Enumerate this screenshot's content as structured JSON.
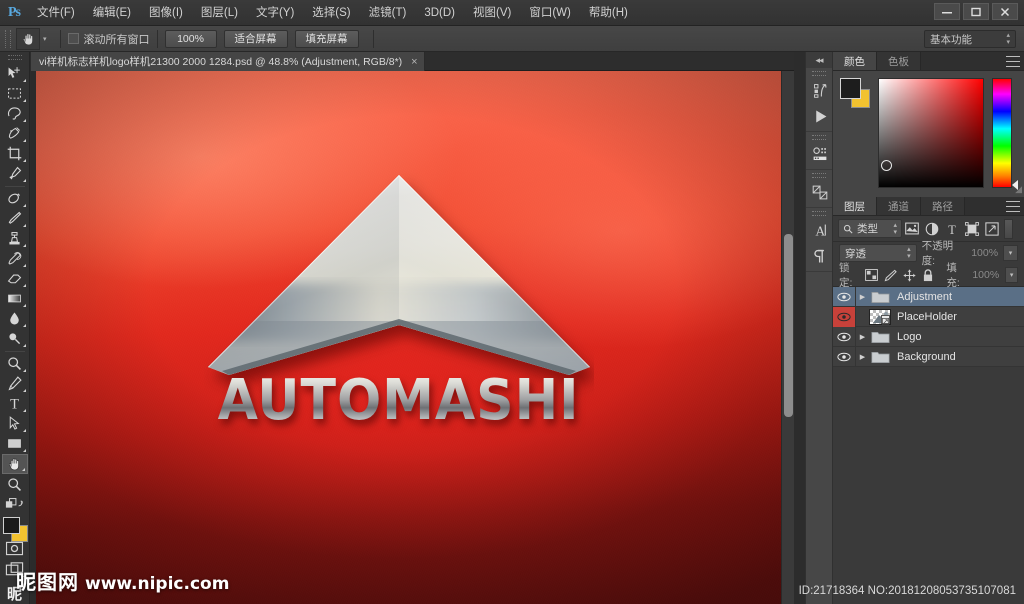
{
  "app": {
    "logo_text": "Ps",
    "workspace": "基本功能"
  },
  "menubar": {
    "items": [
      {
        "label": "文件(F)"
      },
      {
        "label": "编辑(E)"
      },
      {
        "label": "图像(I)"
      },
      {
        "label": "图层(L)"
      },
      {
        "label": "文字(Y)"
      },
      {
        "label": "选择(S)"
      },
      {
        "label": "滤镜(T)"
      },
      {
        "label": "3D(D)"
      },
      {
        "label": "视图(V)"
      },
      {
        "label": "窗口(W)"
      },
      {
        "label": "帮助(H)"
      }
    ]
  },
  "window_controls": {
    "minimize": "—",
    "maximize": "❐",
    "close": "✕"
  },
  "options_bar": {
    "active_tool_icon": "hand-tool-icon",
    "scroll_all_windows_label": "滚动所有窗口",
    "scroll_all_windows_checked": false,
    "buttons": [
      {
        "label": "100%"
      },
      {
        "label": "适合屏幕"
      },
      {
        "label": "填充屏幕"
      }
    ]
  },
  "toolbox": {
    "tools": [
      {
        "name": "move-tool",
        "icon": "move-icon",
        "has_submenu": true
      },
      {
        "name": "rectangular-select-tool",
        "icon": "marquee-icon",
        "has_submenu": true
      },
      {
        "name": "lasso-tool",
        "icon": "lasso-icon",
        "has_submenu": true
      },
      {
        "name": "quick-selection-tool",
        "icon": "quick-select-icon",
        "has_submenu": true
      },
      {
        "name": "crop-tool",
        "icon": "crop-icon",
        "has_submenu": true
      },
      {
        "name": "eyedropper-tool",
        "icon": "eyedropper-icon",
        "has_submenu": true
      },
      {
        "name": "spot-healing-tool",
        "icon": "healing-icon",
        "has_submenu": true
      },
      {
        "name": "brush-tool",
        "icon": "brush-icon",
        "has_submenu": true
      },
      {
        "name": "clone-stamp-tool",
        "icon": "stamp-icon",
        "has_submenu": true
      },
      {
        "name": "history-brush-tool",
        "icon": "history-brush-icon",
        "has_submenu": true
      },
      {
        "name": "eraser-tool",
        "icon": "eraser-icon",
        "has_submenu": true
      },
      {
        "name": "gradient-tool",
        "icon": "gradient-icon",
        "has_submenu": true
      },
      {
        "name": "blur-tool",
        "icon": "blur-drop-icon",
        "has_submenu": true
      },
      {
        "name": "dodge-tool",
        "icon": "dodge-icon",
        "has_submenu": true
      },
      {
        "name": "pen-tool",
        "icon": "pen-icon",
        "has_submenu": true
      },
      {
        "name": "type-tool",
        "icon": "type-T-icon",
        "has_submenu": true
      },
      {
        "name": "path-selection-tool",
        "icon": "path-arrow-icon",
        "has_submenu": true
      },
      {
        "name": "rectangle-shape-tool",
        "icon": "rectangle-icon",
        "has_submenu": true
      },
      {
        "name": "hand-tool",
        "icon": "hand-icon",
        "has_submenu": true,
        "active": true
      },
      {
        "name": "zoom-tool",
        "icon": "magnifier-icon",
        "has_submenu": false
      }
    ],
    "foreground_color": "#1a1a1a",
    "background_color": "#f2c230",
    "quick_mask_icon": "quick-mask-icon",
    "screen_mode_icon": "screen-mode-icon",
    "watermark_glyph": "昵"
  },
  "document": {
    "tab_title": "vi样机标志样机logo样机21300 2000 1284.psd @ 48.8% (Adjustment, RGB/8*)",
    "tab_close": "×",
    "zoom_level": "48.8%",
    "color_mode": "RGB/8*",
    "active_layer": "Adjustment"
  },
  "artwork": {
    "brand_text": "AUTOMASHINE",
    "logo_shape": "chevron-arrow-logo",
    "background_colors": [
      "#fb6d52",
      "#e02a1d",
      "#731210"
    ]
  },
  "icon_dock": {
    "collapse_icon": "collapse-panels-icon",
    "groups": [
      {
        "icons": [
          {
            "name": "history-panel-icon"
          },
          {
            "name": "actions-play-icon"
          }
        ]
      },
      {
        "icons": [
          {
            "name": "properties-panel-icon"
          }
        ]
      },
      {
        "icons": [
          {
            "name": "adjustments-panel-icon"
          }
        ]
      },
      {
        "icons": [
          {
            "name": "character-panel-icon"
          },
          {
            "name": "paragraph-panel-icon"
          }
        ]
      }
    ]
  },
  "color_panel": {
    "tabs": [
      {
        "label": "颜色",
        "active": true
      },
      {
        "label": "色板",
        "active": false
      }
    ],
    "foreground_color": "#1d1d1d",
    "background_color": "#f2c230",
    "picker": "hsb-square-with-hue-strip"
  },
  "layers_panel": {
    "tabs": [
      {
        "label": "图层",
        "active": true
      },
      {
        "label": "通道",
        "active": false
      },
      {
        "label": "路径",
        "active": false
      }
    ],
    "filter": {
      "kind_label": "类型",
      "search_icon": "search-icon",
      "filter_icons": [
        {
          "name": "filter-pixel-icon"
        },
        {
          "name": "filter-adjustment-icon"
        },
        {
          "name": "filter-type-icon"
        },
        {
          "name": "filter-shape-icon"
        },
        {
          "name": "filter-smart-object-icon"
        }
      ],
      "toggle_icon": "filter-enable-toggle"
    },
    "blend_mode": "穿透",
    "opacity_label": "不透明度:",
    "opacity_value": "100%",
    "lock_label": "锁定:",
    "lock_icons": [
      {
        "name": "lock-transparent-pixels-icon"
      },
      {
        "name": "lock-image-pixels-icon"
      },
      {
        "name": "lock-position-icon"
      },
      {
        "name": "lock-all-icon"
      }
    ],
    "fill_label": "填充:",
    "fill_value": "100%",
    "layers": [
      {
        "name": "Adjustment",
        "type": "group",
        "visible": true,
        "selected": true,
        "expanded": false,
        "thumb": "folder-icon"
      },
      {
        "name": "PlaceHolder",
        "type": "smart-object",
        "visible": true,
        "selected": false,
        "expanded": false,
        "thumb": "transparency-checkerboard",
        "eye_highlight": "#c8413a"
      },
      {
        "name": "Logo",
        "type": "group",
        "visible": true,
        "selected": false,
        "expanded": false,
        "thumb": "folder-icon"
      },
      {
        "name": "Background",
        "type": "group",
        "visible": true,
        "selected": false,
        "expanded": false,
        "thumb": "folder-icon"
      }
    ]
  },
  "watermark": {
    "site_cn": "昵图网",
    "site_url": "www.nipic.com",
    "id_text": "ID:21718364 NO:20181208053735107081"
  }
}
